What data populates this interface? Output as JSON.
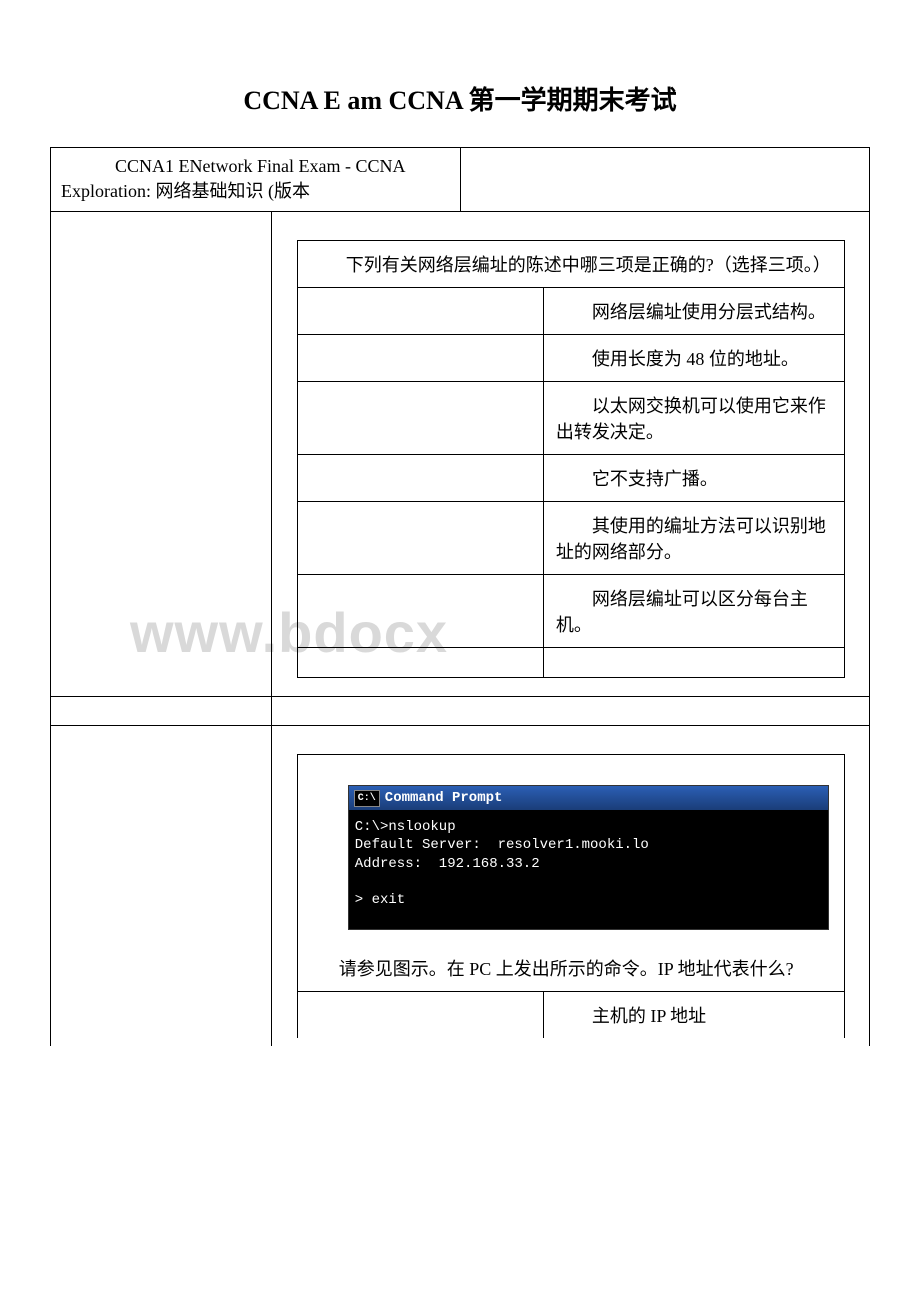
{
  "title": "CCNA E am CCNA 第一学期期末考试",
  "header_cell": "CCNA1 ENetwork Final Exam - CCNA Exploration: 网络基础知识 (版本",
  "watermark": "www.bdocx",
  "q1": {
    "question": "下列有关网络层编址的陈述中哪三项是正确的?（选择三项。）",
    "opts": [
      "网络层编址使用分层式结构。",
      "使用长度为 48 位的地址。",
      "以太网交换机可以使用它来作出转发决定。",
      "它不支持广播。",
      "其使用的编址方法可以识别地址的网络部分。",
      "网络层编址可以区分每台主机。"
    ]
  },
  "q2": {
    "cmd_title": "Command Prompt",
    "cmd_icon": "C:\\",
    "cmd_body": "C:\\>nslookup\nDefault Server:  resolver1.mooki.lo\nAddress:  192.168.33.2\n\n> exit",
    "question": "请参见图示。在 PC 上发出所示的命令。IP 地址代表什么?",
    "opts": [
      "主机的 IP 地址"
    ]
  }
}
